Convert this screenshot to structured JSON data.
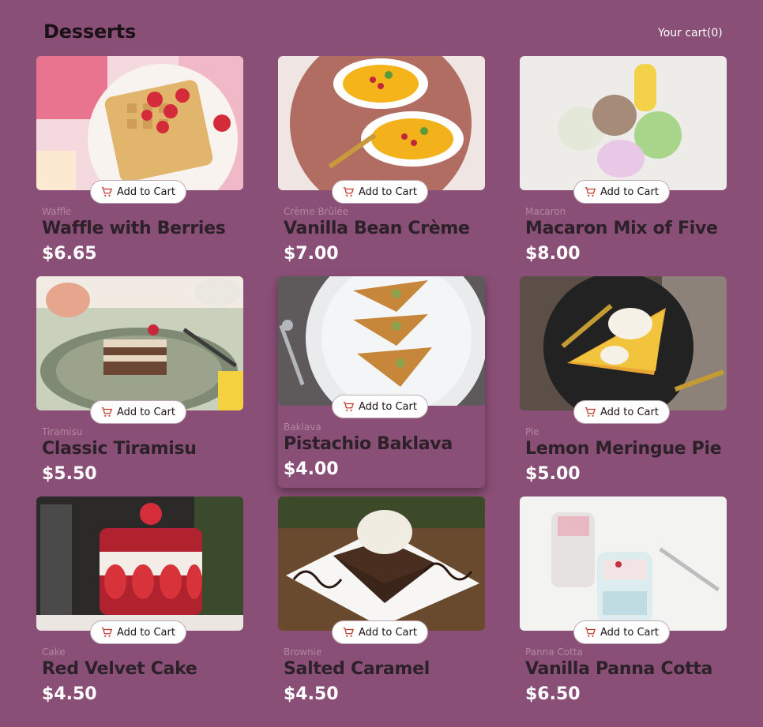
{
  "header": {
    "title": "Desserts",
    "cart_label": "Your cart(0)"
  },
  "button_label": "Add to Cart",
  "colors": {
    "background": "#8a4f76",
    "price": "#ffffff",
    "name": "#2d2129",
    "category": "#b1879f",
    "cart_icon": "#c0392b"
  },
  "products": [
    {
      "category": "Waffle",
      "name": "Waffle with Berries",
      "price": "$6.65",
      "icon": "cart-icon"
    },
    {
      "category": "Crème Brûlée",
      "name": "Vanilla Bean Crème",
      "price": "$7.00",
      "icon": "cart-icon"
    },
    {
      "category": "Macaron",
      "name": "Macaron Mix of Five",
      "price": "$8.00",
      "icon": "cart-icon"
    },
    {
      "category": "Tiramisu",
      "name": "Classic Tiramisu",
      "price": "$5.50",
      "icon": "cart-icon"
    },
    {
      "category": "Baklava",
      "name": "Pistachio Baklava",
      "price": "$4.00",
      "icon": "cart-icon"
    },
    {
      "category": "Pie",
      "name": "Lemon Meringue Pie",
      "price": "$5.00",
      "icon": "cart-icon"
    },
    {
      "category": "Cake",
      "name": "Red Velvet Cake",
      "price": "$4.50",
      "icon": "cart-icon"
    },
    {
      "category": "Brownie",
      "name": "Salted Caramel",
      "price": "$4.50",
      "icon": "cart-icon"
    },
    {
      "category": "Panna Cotta",
      "name": "Vanilla Panna Cotta",
      "price": "$6.50",
      "icon": "cart-icon"
    }
  ]
}
